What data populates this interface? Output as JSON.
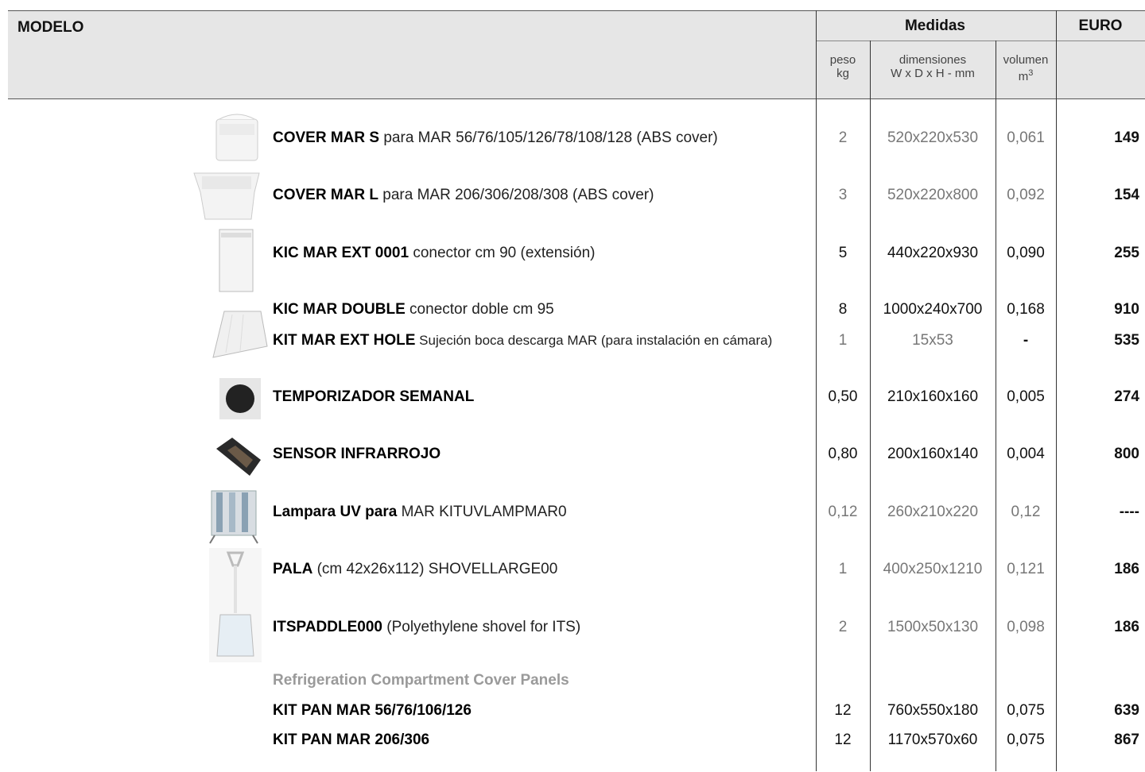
{
  "header": {
    "modelo": "MODELO",
    "medidas": "Medidas",
    "euro": "EURO",
    "peso_1": "peso",
    "peso_2": "kg",
    "dim_1": "dimensiones",
    "dim_2": "W x D x H - mm",
    "vol_1": "volumen",
    "vol_2": "m3"
  },
  "rows": [
    {
      "name": "COVER MAR S",
      "desc": " para MAR 56/76/105/126/78/108/128 (ABS cover)",
      "peso": "2",
      "dim": "520x220x530",
      "vol": "0,061",
      "euro": "149"
    },
    {
      "name": "COVER MAR L",
      "desc": " para MAR 206/306/208/308 (ABS cover)",
      "peso": "3",
      "dim": "520x220x800",
      "vol": "0,092",
      "euro": "154"
    },
    {
      "name": "KIC MAR EXT 0001",
      "desc": " conector cm 90 (extensión)",
      "peso": "5",
      "dim": "440x220x930",
      "vol": "0,090",
      "euro": "255"
    },
    {
      "name": "KIC MAR DOUBLE",
      "desc": " conector doble cm 95",
      "peso": "8",
      "dim": "1000x240x700",
      "vol": "0,168",
      "euro": "910"
    },
    {
      "name": "KIT MAR EXT HOLE",
      "desc": " Sujeción boca descarga MAR (para instalación en cámara)",
      "peso": "1",
      "dim": "15x53",
      "vol": "-",
      "euro": "535"
    },
    {
      "name": "TEMPORIZADOR SEMANAL",
      "desc": "",
      "peso": "0,50",
      "dim": "210x160x160",
      "vol": "0,005",
      "euro": "274"
    },
    {
      "name": "SENSOR INFRARROJO",
      "desc": "",
      "peso": "0,80",
      "dim": "200x160x140",
      "vol": "0,004",
      "euro": "800"
    },
    {
      "name": "Lampara UV para",
      "desc": " MAR KITUVLAMPMAR0",
      "peso": "0,12",
      "dim": "260x210x220",
      "vol": "0,12",
      "euro": "----"
    },
    {
      "name": "PALA",
      "desc": " (cm 42x26x112) SHOVELLARGE00",
      "peso": "1",
      "dim": "400x250x1210",
      "vol": "0,121",
      "euro": "186"
    },
    {
      "name": "ITSPADDLE000",
      "desc": " (Polyethylene shovel for ITS)",
      "peso": "2",
      "dim": "1500x50x130",
      "vol": "0,098",
      "euro": "186"
    },
    {
      "name": "Refrigeration Compartment Cover Panels",
      "desc": "",
      "peso": "",
      "dim": "",
      "vol": "",
      "euro": ""
    },
    {
      "name": "KIT PAN MAR 56/76/106/126",
      "desc": "",
      "peso": "12",
      "dim": "760x550x180",
      "vol": "0,075",
      "euro": "639"
    },
    {
      "name": "KIT PAN MAR 206/306",
      "desc": "",
      "peso": "12",
      "dim": "1170x570x60",
      "vol": "0,075",
      "euro": "867"
    }
  ],
  "images": [
    "cover-mar-s",
    "cover-mar-l",
    "kic-mar-ext",
    "kic-mar-double",
    "timer",
    "infrared-sensor",
    "uv-lamp",
    "shovel"
  ]
}
